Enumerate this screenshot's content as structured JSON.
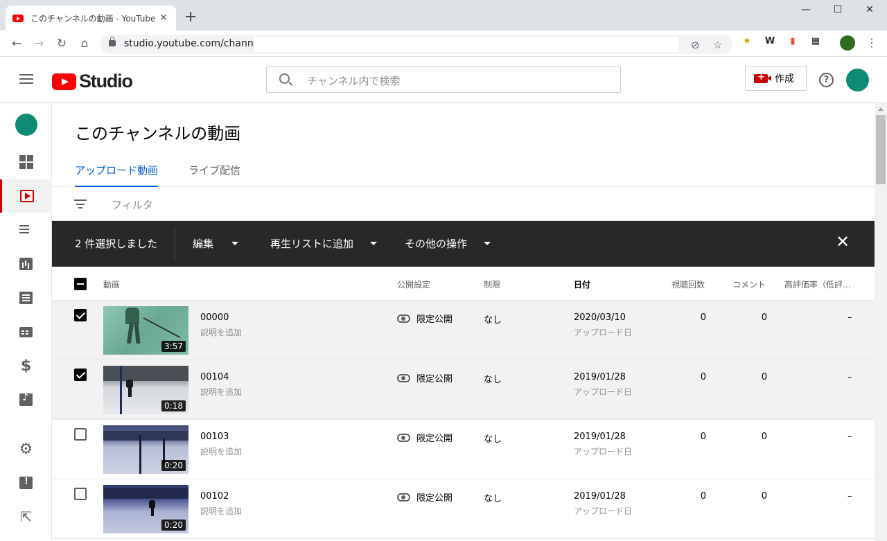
{
  "browser": {
    "tab_title": "このチャンネルの動画 - YouTube Studio",
    "url": "studio.youtube.com/channel/"
  },
  "header": {
    "logo_text": "Studio",
    "search_placeholder": "チャンネル内で検索",
    "create_label": "作成"
  },
  "page": {
    "title": "このチャンネルの動画",
    "tabs": [
      {
        "label": "アップロード動画",
        "active": true
      },
      {
        "label": "ライブ配信",
        "active": false
      }
    ],
    "filter_label": "フィルタ"
  },
  "action_bar": {
    "selected_text": "2 件選択しました",
    "edit_label": "編集",
    "playlist_label": "再生リストに追加",
    "more_label": "その他の操作"
  },
  "table": {
    "headers": {
      "video": "動画",
      "visibility": "公開設定",
      "restrictions": "制限",
      "date": "日付",
      "views": "視聴回数",
      "comments": "コメント",
      "likes": "高評価率（低評…"
    },
    "rows": [
      {
        "title": "00000",
        "desc": "説明を追加",
        "duration": "3:57",
        "visibility": "限定公開",
        "restrictions": "なし",
        "date": "2020/03/10",
        "date_sub": "アップロード日",
        "views": "0",
        "comments": "0",
        "likes": "–",
        "checked": true
      },
      {
        "title": "00104",
        "desc": "説明を追加",
        "duration": "0:18",
        "visibility": "限定公開",
        "restrictions": "なし",
        "date": "2019/01/28",
        "date_sub": "アップロード日",
        "views": "0",
        "comments": "0",
        "likes": "–",
        "checked": true
      },
      {
        "title": "00103",
        "desc": "説明を追加",
        "duration": "0:20",
        "visibility": "限定公開",
        "restrictions": "なし",
        "date": "2019/01/28",
        "date_sub": "アップロード日",
        "views": "0",
        "comments": "0",
        "likes": "–",
        "checked": false
      },
      {
        "title": "00102",
        "desc": "説明を追加",
        "duration": "0:20",
        "visibility": "限定公開",
        "restrictions": "なし",
        "date": "2019/01/28",
        "date_sub": "アップロード日",
        "views": "0",
        "comments": "0",
        "likes": "–",
        "checked": false
      }
    ]
  },
  "colors": {
    "accent_red": "#cc0000",
    "link_blue": "#065fd4",
    "action_bar_bg": "#282828",
    "avatar": "#0f8a74"
  },
  "icons": {
    "nav": [
      "dashboard-icon",
      "videos-icon",
      "playlists-icon",
      "analytics-icon",
      "comments-icon",
      "subtitles-icon",
      "monetization-icon",
      "audio-library-icon",
      "settings-icon",
      "feedback-icon",
      "classic-studio-icon"
    ]
  }
}
